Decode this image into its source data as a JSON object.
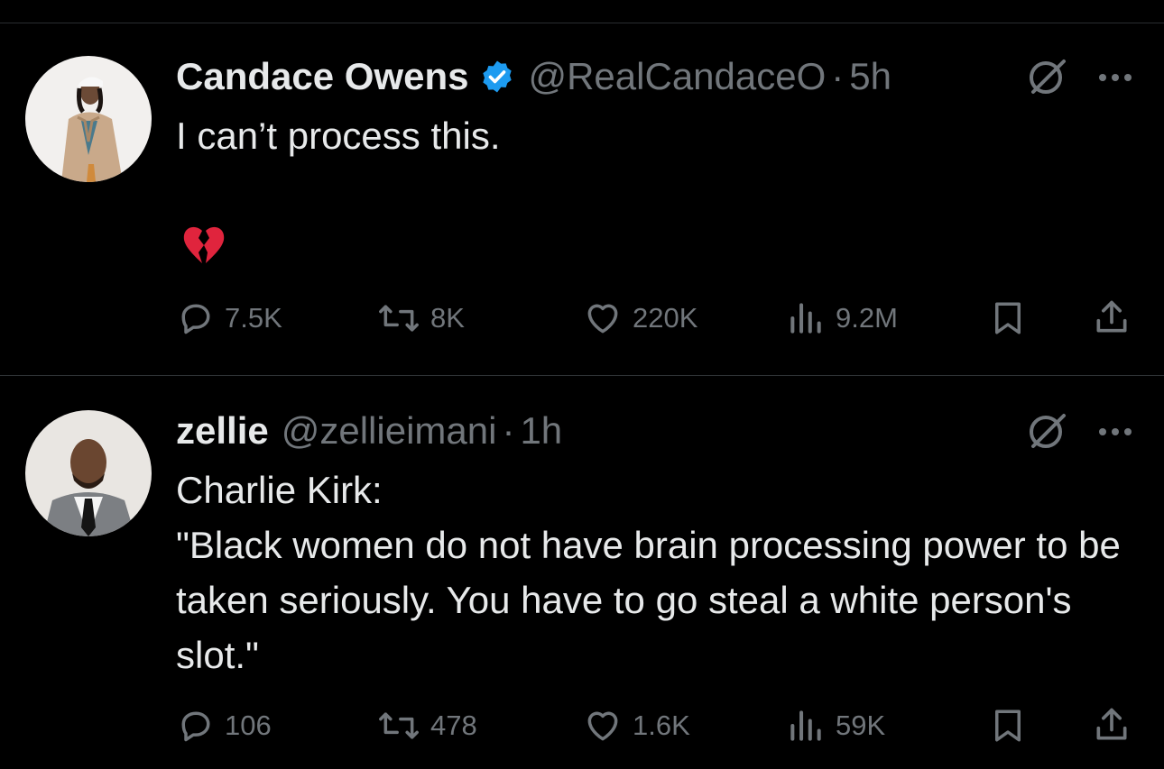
{
  "tweets": [
    {
      "name": "Candace Owens",
      "verified": true,
      "handle": "@RealCandaceO",
      "separator": "·",
      "time": "5h",
      "text": "I can’t process this.",
      "emoji": "broken-heart",
      "stats": {
        "replies": "7.5K",
        "reposts": "8K",
        "likes": "220K",
        "views": "9.2M"
      }
    },
    {
      "name": "zellie",
      "verified": false,
      "handle": "@zellieimani",
      "separator": "·",
      "time": "1h",
      "text": "Charlie Kirk:\n\"Black women do not have brain processing power to be taken seriously. You have to go steal a white person's slot.\"",
      "stats": {
        "replies": "106",
        "reposts": "478",
        "likes": "1.6K",
        "views": "59K"
      }
    }
  ],
  "icons": {
    "reply": "reply-icon",
    "repost": "repost-icon",
    "like": "heart-icon",
    "views": "views-icon",
    "bookmark": "bookmark-icon",
    "share": "share-icon",
    "grok": "grok-icon",
    "more": "more-icon",
    "verified": "verified-badge-icon"
  },
  "colors": {
    "background": "#000000",
    "text": "#e7e9ea",
    "muted": "#71767b",
    "verified": "#1d9bf0"
  }
}
